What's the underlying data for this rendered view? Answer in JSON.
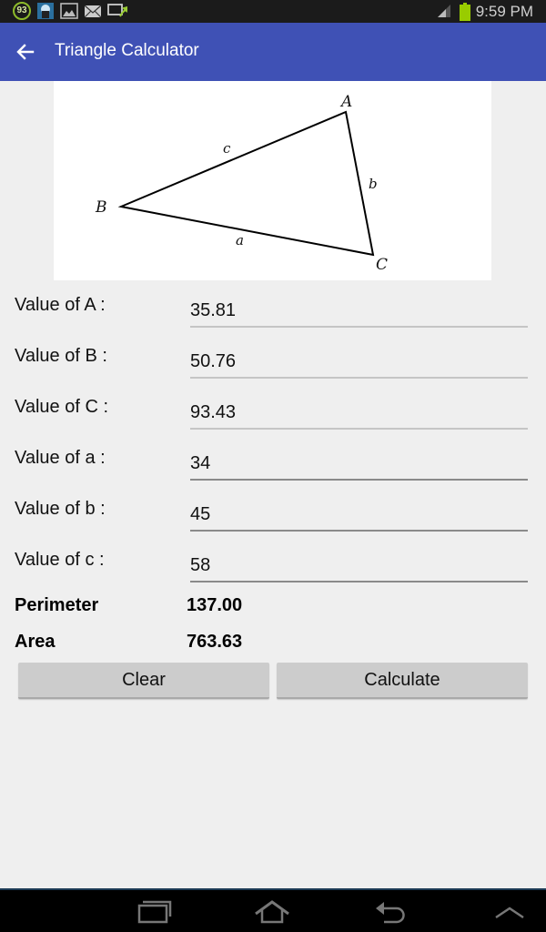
{
  "status_bar": {
    "notification_badge": "93",
    "icons": [
      "battery-saver-badge-icon",
      "app-notification-icon",
      "gallery-icon",
      "email-icon",
      "screen-share-icon"
    ],
    "time": "9:59 PM",
    "signal_icon": "signal-icon",
    "battery_icon": "battery-icon",
    "battery_color": "#99cc00"
  },
  "app_bar": {
    "title": "Triangle Calculator",
    "back_icon": "arrow-left-icon",
    "color": "#3f51b5"
  },
  "diagram": {
    "vertex_labels": {
      "A": "A",
      "B": "B",
      "C": "C"
    },
    "side_labels": {
      "a": "a",
      "b": "b",
      "c": "c"
    }
  },
  "form": {
    "fields": [
      {
        "label": "Value of A :",
        "value": "35.81",
        "editable": false
      },
      {
        "label": "Value of B :",
        "value": "50.76",
        "editable": false
      },
      {
        "label": "Value of C :",
        "value": "93.43",
        "editable": false
      },
      {
        "label": "Value of a :",
        "value": "34",
        "editable": true
      },
      {
        "label": "Value of b :",
        "value": "45",
        "editable": true
      },
      {
        "label": "Value of c :",
        "value": "58",
        "editable": true
      }
    ]
  },
  "results": {
    "perimeter_label": "Perimeter",
    "perimeter_value": "137.00",
    "area_label": "Area",
    "area_value": "763.63"
  },
  "buttons": {
    "clear_label": "Clear",
    "calculate_label": "Calculate"
  },
  "nav_bar": {
    "items": [
      "recent-apps-icon",
      "home-icon",
      "back-icon",
      "menu-up-icon"
    ]
  }
}
